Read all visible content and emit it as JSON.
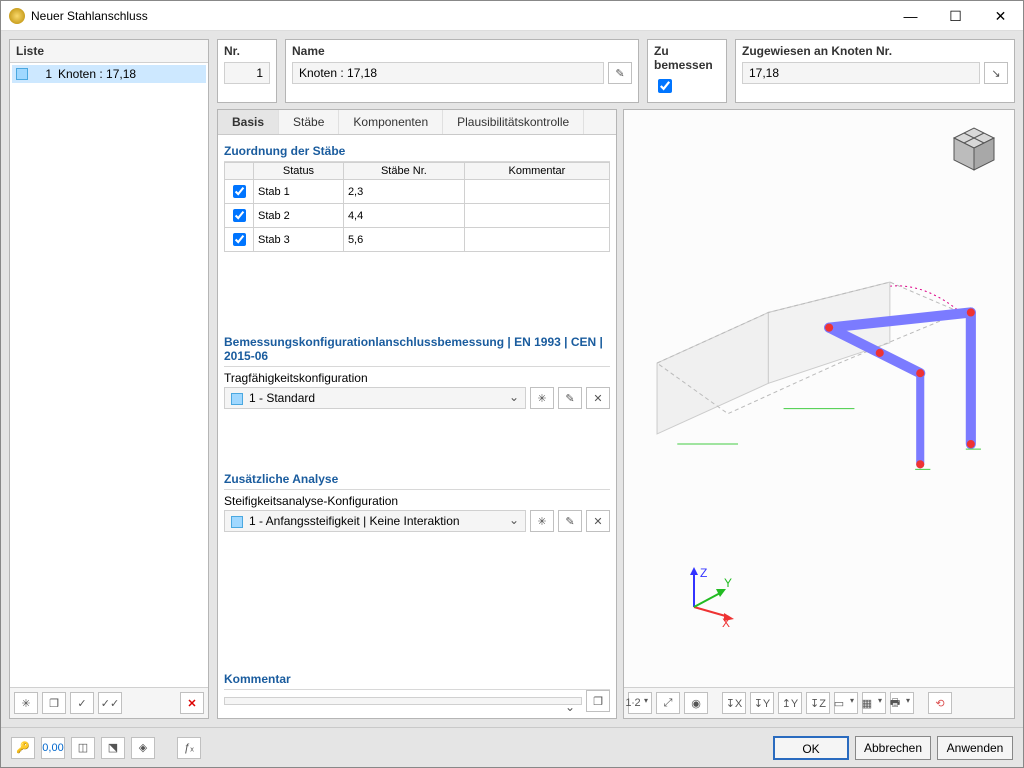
{
  "window": {
    "title": "Neuer Stahlanschluss"
  },
  "liste": {
    "header": "Liste",
    "items": [
      {
        "num": "1",
        "label": "Knoten : 17,18"
      }
    ]
  },
  "nr": {
    "label": "Nr.",
    "value": "1"
  },
  "name": {
    "label": "Name",
    "value": "Knoten : 17,18"
  },
  "zu_bemessen": {
    "label": "Zu bemessen",
    "checked": true
  },
  "zugewiesen": {
    "label": "Zugewiesen an Knoten Nr.",
    "value": "17,18"
  },
  "tabs": [
    "Basis",
    "Stäbe",
    "Komponenten",
    "Plausibilitätskontrolle"
  ],
  "zuordnung": {
    "title": "Zuordnung der Stäbe",
    "headers": [
      "Status",
      "Stäbe Nr.",
      "Kommentar"
    ],
    "rows": [
      {
        "chk": true,
        "status": "Stab 1",
        "nr": "2,3",
        "komm": ""
      },
      {
        "chk": true,
        "status": "Stab 2",
        "nr": "4,4",
        "komm": ""
      },
      {
        "chk": true,
        "status": "Stab 3",
        "nr": "5,6",
        "komm": ""
      }
    ]
  },
  "bemessung": {
    "title": "Bemessungskonfigurationlanschlussbemessung | EN 1993 | CEN | 2015-06",
    "sub": "Tragfähigkeitskonfiguration",
    "value": "1 - Standard"
  },
  "zusatz": {
    "title": "Zusätzliche Analyse",
    "sub": "Steifigkeitsanalyse-Konfiguration",
    "value": "1 - Anfangssteifigkeit | Keine Interaktion"
  },
  "kommentar": {
    "title": "Kommentar",
    "value": ""
  },
  "axes": {
    "x": "X",
    "y": "Y",
    "z": "Z"
  },
  "buttons": {
    "ok": "OK",
    "cancel": "Abbrechen",
    "apply": "Anwenden"
  }
}
